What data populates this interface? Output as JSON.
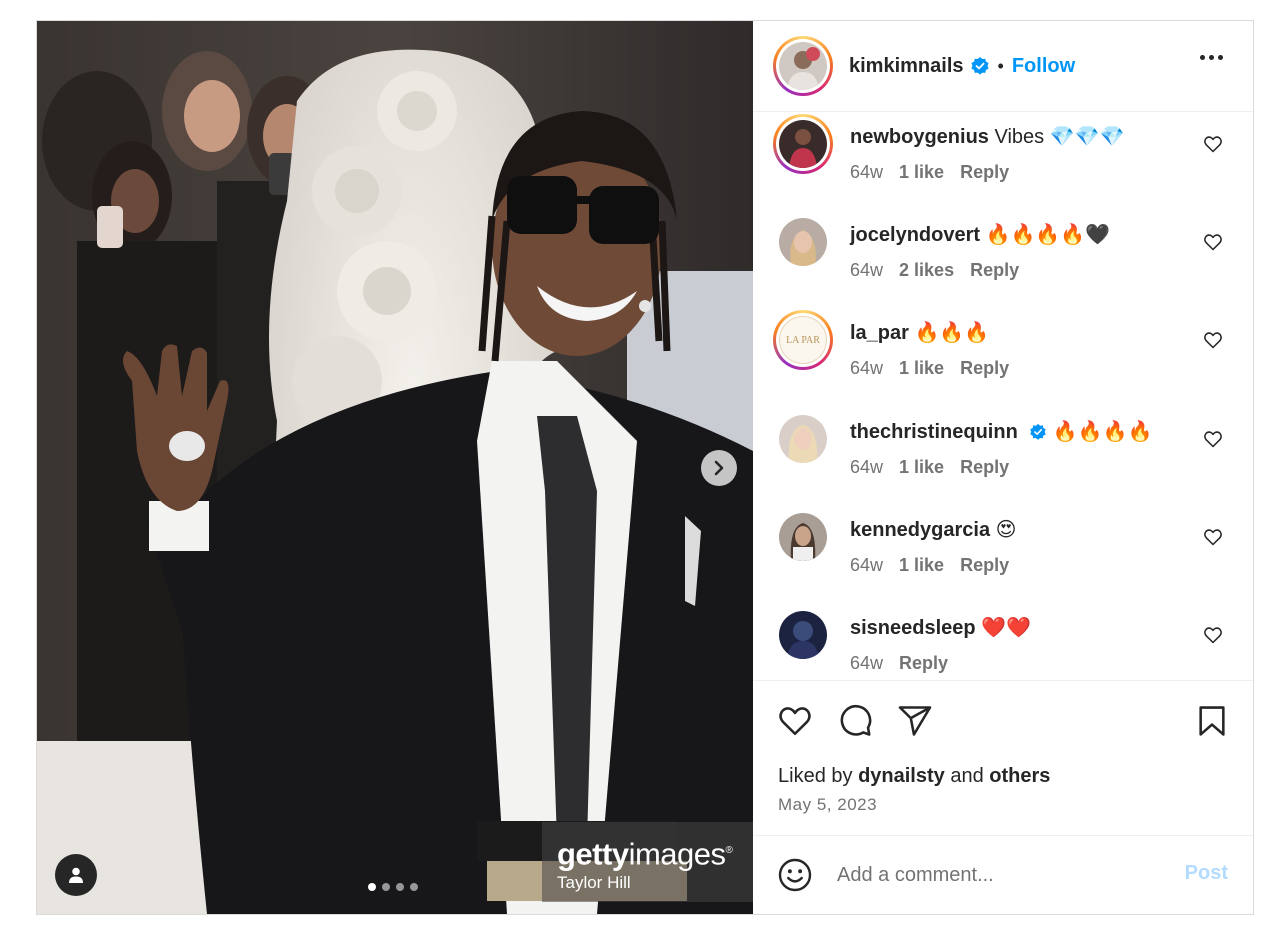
{
  "header": {
    "username": "kimkimnails",
    "follow_label": "Follow",
    "separator": "•"
  },
  "media": {
    "watermark_brand_bold": "getty",
    "watermark_brand_light": "images",
    "watermark_registered": "®",
    "photographer_credit": "Taylor Hill",
    "carousel_count": 4,
    "carousel_active": 1
  },
  "comments": [
    {
      "username": "newboygenius",
      "text": "Vibes 💎💎💎",
      "time": "64w",
      "likes": "1 like",
      "reply": "Reply",
      "verified": false,
      "story_ring": true
    },
    {
      "username": "jocelyndovert",
      "text": "🔥🔥🔥🔥🖤",
      "time": "64w",
      "likes": "2 likes",
      "reply": "Reply",
      "verified": false,
      "story_ring": false
    },
    {
      "username": "la_par",
      "text": "🔥🔥🔥",
      "time": "64w",
      "likes": "1 like",
      "reply": "Reply",
      "verified": false,
      "story_ring": true,
      "avatar_text": "LA PAR"
    },
    {
      "username": "thechristinequinn",
      "text": "🔥🔥🔥🔥",
      "time": "64w",
      "likes": "1 like",
      "reply": "Reply",
      "verified": true,
      "story_ring": false
    },
    {
      "username": "kennedygarcia",
      "text": "😍",
      "time": "64w",
      "likes": "1 like",
      "reply": "Reply",
      "verified": false,
      "story_ring": false
    },
    {
      "username": "sisneedsleep",
      "text": "❤️❤️",
      "time": "64w",
      "likes": "",
      "reply": "Reply",
      "verified": false,
      "story_ring": false
    }
  ],
  "likes": {
    "prefix": "Liked by",
    "user": "dynailsty",
    "conjunction": "and",
    "others": "others"
  },
  "post_date": "May 5, 2023",
  "add_comment": {
    "placeholder": "Add a comment...",
    "post_label": "Post"
  },
  "colors": {
    "accent": "#0095f6",
    "verified": "#0095f6",
    "post_disabled": "#b3dbff",
    "muted_text": "#737373"
  },
  "icons": [
    "heart-icon",
    "comment-icon",
    "share-icon",
    "bookmark-icon",
    "emoji-icon",
    "more-icon",
    "verified-badge-icon",
    "chevron-right-icon",
    "user-tag-icon"
  ]
}
